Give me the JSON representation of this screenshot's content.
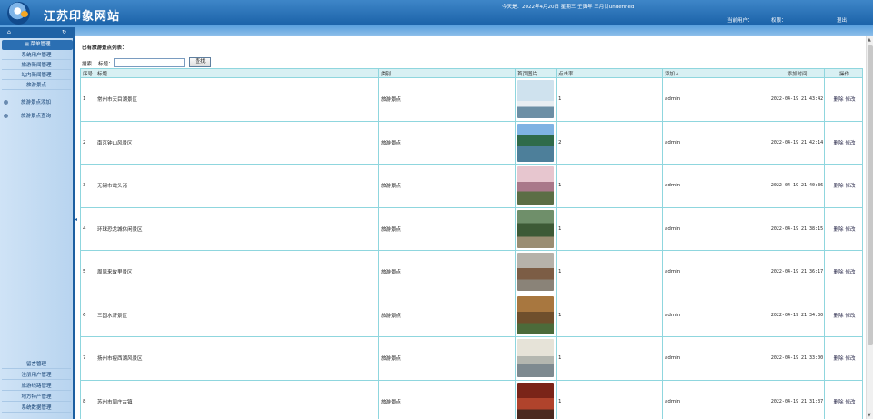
{
  "header": {
    "site_title": "江苏印象网站",
    "date_info": "今天是：2022年4月20日  星期三  壬寅年 三月廿undefined",
    "current_user_label": "当前用户：",
    "role_label": "权限：",
    "logout_label": "退出"
  },
  "sidebar": {
    "section_title": "菜单管理",
    "top_items": [
      "系统用户管理",
      "旅游新闻管理",
      "站内新闻管理",
      "旅游景点"
    ],
    "sub_items": [
      "旅游景点添加",
      "旅游景点查询"
    ],
    "bottom_items": [
      "留言管理",
      "注册用户管理",
      "旅游线路管理",
      "地方特产管理",
      "系统数据管理"
    ]
  },
  "main": {
    "list_title": "已有旅游景点列表：",
    "search_label": "搜索",
    "title_label": "标题：",
    "search_input_value": "",
    "search_button": "查找",
    "columns": [
      "序号",
      "标题",
      "类别",
      "首页图片",
      "点击率",
      "添加人",
      "添加时间",
      "操作"
    ],
    "delete_label": "删除",
    "edit_label": "修改",
    "rows": [
      {
        "no": "1",
        "title": "常州市天目湖景区",
        "category": "旅游景点",
        "clicks": "1",
        "author": "admin",
        "time": "2022-04-19 21:43:42"
      },
      {
        "no": "2",
        "title": "南京钟山风景区",
        "category": "旅游景点",
        "clicks": "2",
        "author": "admin",
        "time": "2022-04-19 21:42:14"
      },
      {
        "no": "3",
        "title": "无锡市鼋头渚",
        "category": "旅游景点",
        "clicks": "1",
        "author": "admin",
        "time": "2022-04-19 21:40:36"
      },
      {
        "no": "4",
        "title": "环球恐龙城休闲景区",
        "category": "旅游景点",
        "clicks": "1",
        "author": "admin",
        "time": "2022-04-19 21:38:15"
      },
      {
        "no": "5",
        "title": "周恩来故里景区",
        "category": "旅游景点",
        "clicks": "1",
        "author": "admin",
        "time": "2022-04-19 21:36:17"
      },
      {
        "no": "6",
        "title": "三国水浒景区",
        "category": "旅游景点",
        "clicks": "1",
        "author": "admin",
        "time": "2022-04-19 21:34:30"
      },
      {
        "no": "7",
        "title": "扬州市瘦西湖风景区",
        "category": "旅游景点",
        "clicks": "1",
        "author": "admin",
        "time": "2022-04-19 21:33:00"
      },
      {
        "no": "8",
        "title": "苏州市周庄古镇",
        "category": "旅游景点",
        "clicks": "1",
        "author": "admin",
        "time": "2022-04-19 21:31:37"
      }
    ]
  },
  "colors": {
    "header_blue": "#1b62a8",
    "table_border": "#8fd6de",
    "sidebar_bg": "#cfe3f6"
  }
}
